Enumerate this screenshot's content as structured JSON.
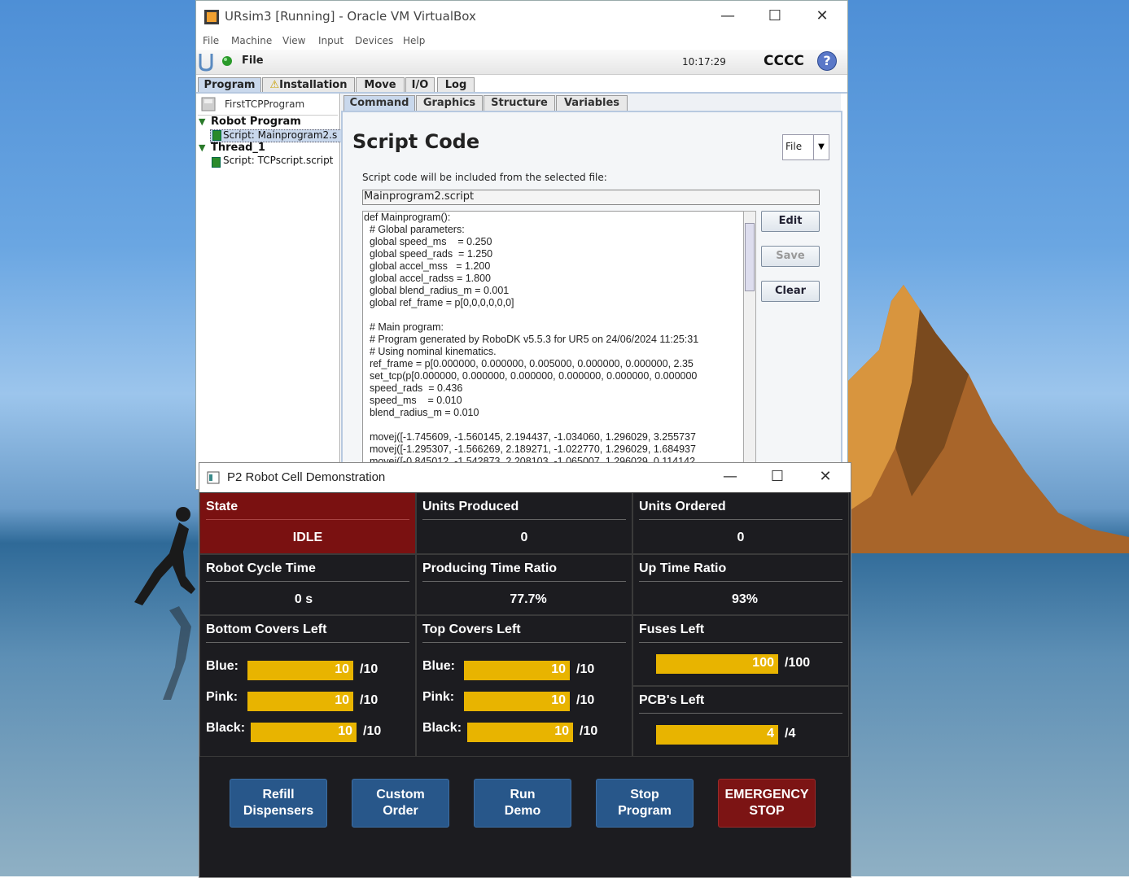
{
  "vbox": {
    "title": "URsim3 [Running] - Oracle VM VirtualBox",
    "menu": [
      "File",
      "Machine",
      "View",
      "Input",
      "Devices",
      "Help"
    ],
    "ur_file": "File",
    "clock": "10:17:29",
    "robot_name": "CCCC",
    "help_icon": "?",
    "main_tabs": [
      "Program",
      "Installation",
      "Move",
      "I/O",
      "Log"
    ],
    "program_name": "FirstTCPProgram",
    "tree": {
      "robot_program": "Robot Program",
      "script1": "Script: Mainprogram2.s",
      "thread": "Thread_1",
      "script2": "Script: TCPscript.script"
    },
    "sub_tabs": [
      "Command",
      "Graphics",
      "Structure",
      "Variables"
    ],
    "heading": "Script Code",
    "source_select": "File",
    "instructions": "Script code will be included from the selected file:",
    "filename": "Mainprogram2.script",
    "buttons": {
      "edit": "Edit",
      "save": "Save",
      "clear": "Clear"
    },
    "code_lines": [
      "def Mainprogram():",
      "  # Global parameters:",
      "  global speed_ms    = 0.250",
      "  global speed_rads  = 1.250",
      "  global accel_mss   = 1.200",
      "  global accel_radss = 1.800",
      "  global blend_radius_m = 0.001",
      "  global ref_frame = p[0,0,0,0,0,0]",
      "",
      "  # Main program:",
      "  # Program generated by RoboDK v5.5.3 for UR5 on 24/06/2024 11:25:31",
      "  # Using nominal kinematics.",
      "  ref_frame = p[0.000000, 0.000000, 0.005000, 0.000000, 0.000000, 2.35",
      "  set_tcp(p[0.000000, 0.000000, 0.000000, 0.000000, 0.000000, 0.000000",
      "  speed_rads  = 0.436",
      "  speed_ms    = 0.010",
      "  blend_radius_m = 0.010",
      "",
      "  movej([-1.745609, -1.560145, 2.194437, -1.034060, 1.296029, 3.255737",
      "  movej([-1.295307, -1.566269, 2.189271, -1.022770, 1.296029, 1.684937",
      "  movej([-0.845012, -1.542873, 2.208103, -1.065007, 1.296029, 0.114142"
    ]
  },
  "p2": {
    "title": "P2 Robot Cell Demonstration",
    "state": {
      "label": "State",
      "value": "IDLE"
    },
    "units_produced": {
      "label": "Units Produced",
      "value": "0"
    },
    "units_ordered": {
      "label": "Units Ordered",
      "value": "0"
    },
    "cycle_time": {
      "label": "Robot Cycle Time",
      "value": "0 s"
    },
    "producing_ratio": {
      "label": "Producing Time Ratio",
      "value": "77.7%"
    },
    "uptime_ratio": {
      "label": "Up Time Ratio",
      "value": "93%"
    },
    "bottom_covers": {
      "label": "Bottom Covers Left",
      "rows": [
        {
          "name": "Blue:",
          "value": "10",
          "max": "/10",
          "fraction": 1.0
        },
        {
          "name": "Pink:",
          "value": "10",
          "max": "/10",
          "fraction": 1.0
        },
        {
          "name": "Black:",
          "value": "10",
          "max": "/10",
          "fraction": 1.0
        }
      ]
    },
    "top_covers": {
      "label": "Top Covers Left",
      "rows": [
        {
          "name": "Blue:",
          "value": "10",
          "max": "/10",
          "fraction": 1.0
        },
        {
          "name": "Pink:",
          "value": "10",
          "max": "/10",
          "fraction": 1.0
        },
        {
          "name": "Black:",
          "value": "10",
          "max": "/10",
          "fraction": 1.0
        }
      ]
    },
    "fuses": {
      "label": "Fuses Left",
      "value": "100",
      "max": "/100",
      "fraction": 1.0
    },
    "pcbs": {
      "label": "PCB's Left",
      "value": "4",
      "max": "/4",
      "fraction": 1.0
    },
    "actions": {
      "refill_1": "Refill",
      "refill_2": "Dispensers",
      "custom_1": "Custom",
      "custom_2": "Order",
      "run_1": "Run",
      "run_2": "Demo",
      "stop_1": "Stop",
      "stop_2": "Program",
      "emergency_1": "EMERGENCY",
      "emergency_2": "STOP"
    },
    "colors": {
      "state_bg": "#7a1111",
      "bar": "#e8b400",
      "button": "#28578a",
      "emergency": "#7c1414"
    }
  }
}
